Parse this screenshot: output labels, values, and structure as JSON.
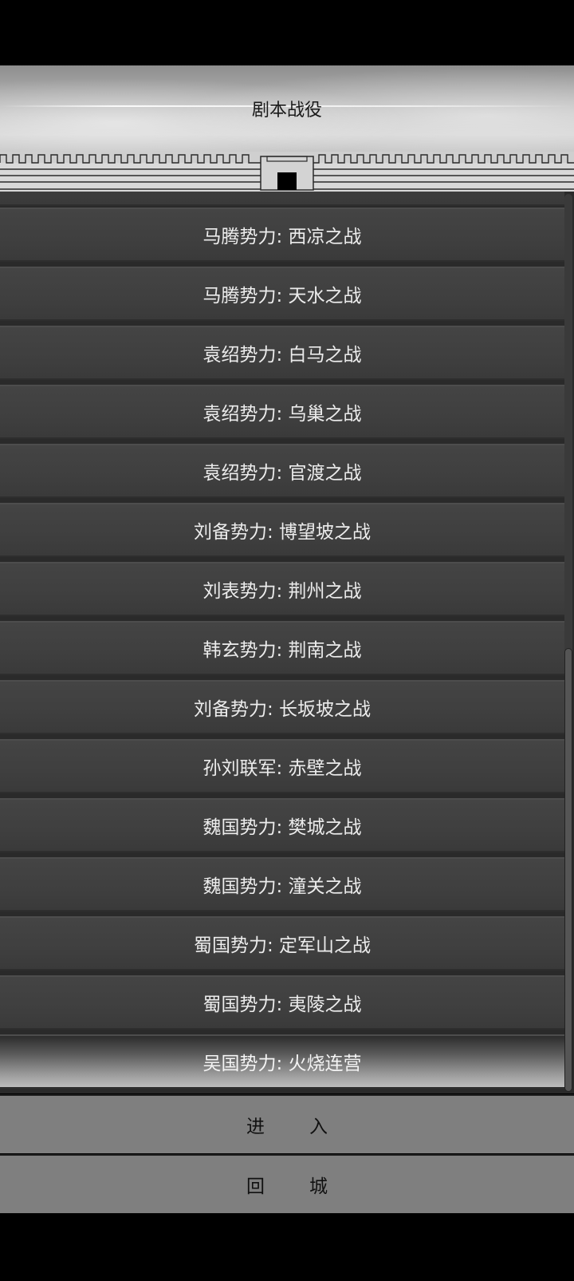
{
  "header": {
    "title": "剧本战役"
  },
  "battles": [
    {
      "label": "马腾势力: 西凉之战"
    },
    {
      "label": "马腾势力: 天水之战"
    },
    {
      "label": "袁绍势力: 白马之战"
    },
    {
      "label": "袁绍势力: 乌巢之战"
    },
    {
      "label": "袁绍势力: 官渡之战"
    },
    {
      "label": "刘备势力: 博望坡之战"
    },
    {
      "label": "刘表势力: 荆州之战"
    },
    {
      "label": "韩玄势力: 荆南之战"
    },
    {
      "label": "刘备势力: 长坂坡之战"
    },
    {
      "label": "孙刘联军: 赤壁之战"
    },
    {
      "label": "魏国势力: 樊城之战"
    },
    {
      "label": "魏国势力: 潼关之战"
    },
    {
      "label": "蜀国势力: 定军山之战"
    },
    {
      "label": "蜀国势力: 夷陵之战"
    },
    {
      "label": "吴国势力: 火烧连营",
      "selected": true
    }
  ],
  "buttons": {
    "enter": [
      "进",
      "入"
    ],
    "return_city": [
      "回",
      "城"
    ]
  }
}
